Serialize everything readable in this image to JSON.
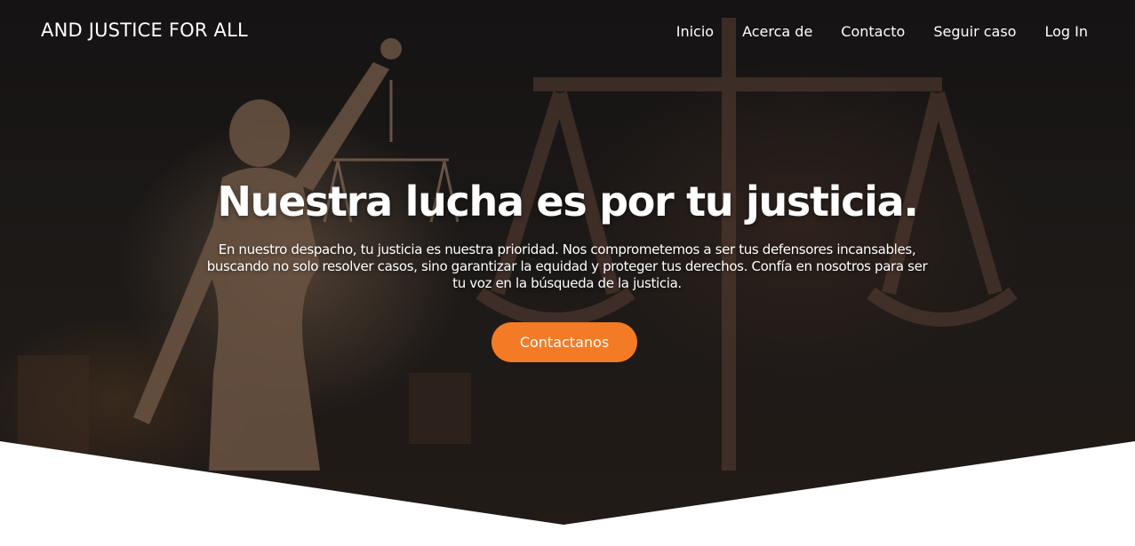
{
  "header": {
    "logo": "AND JUSTICE FOR ALL",
    "nav": {
      "home": "Inicio",
      "about": "Acerca de",
      "contact": "Contacto",
      "track_case": "Seguir caso",
      "login": "Log In"
    }
  },
  "hero": {
    "headline": "Nuestra lucha es por tu justicia.",
    "description": "En nuestro despacho, tu justicia es nuestra prioridad. Nos comprometemos a ser tus defensores incansables, buscando no solo resolver casos, sino garantizar la equidad y proteger tus derechos. Confía en nosotros para ser tu voz en la búsqueda de la justicia.",
    "cta_label": "Contactanos",
    "background_image": "lady-justice-statue-with-scales",
    "accent_color": "#f47b25"
  }
}
